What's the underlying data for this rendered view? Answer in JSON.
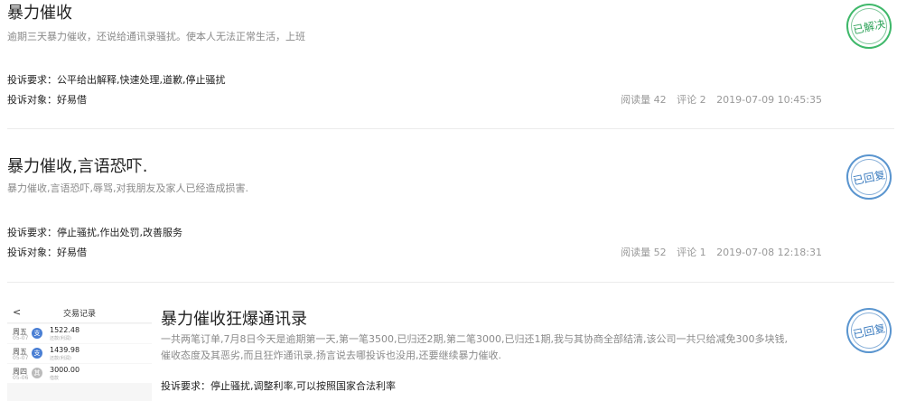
{
  "items": [
    {
      "title": "暴力催收",
      "desc": "逾期三天暴力催收，还说给通讯录骚扰。使本人无法正常生活，上班",
      "demand": "投诉要求：公平给出解释,快速处理,道歉,停止骚扰",
      "target": "投诉对象：好易借",
      "reads": "阅读量 42",
      "comments": "评论 2",
      "time": "2019-07-09 10:45:35",
      "status": "已解决",
      "status_color": "#3fb86a"
    },
    {
      "title": "暴力催收,言语恐吓.",
      "desc": "暴力催收,言语恐吓,辱骂,对我朋友及家人已经造成损害.",
      "demand": "投诉要求：停止骚扰,作出处罚,改善服务",
      "target": "投诉对象：好易借",
      "reads": "阅读量 52",
      "comments": "评论 1",
      "time": "2019-07-08 12:18:31",
      "status": "已回复",
      "status_color": "#5a95cf"
    },
    {
      "title": "暴力催收狂爆通讯录",
      "desc_line1": "一共两笔订单,7月8日今天是逾期第一天,第一笔3500,已归还2期,第二笔3000,已归还1期,我与其协商全部结清,该公司一共只给减免300多块钱,",
      "desc_line2": "催收态度及其恶劣,而且狂炸通讯录,扬言说去哪投诉也没用,还要继续暴力催收.",
      "demand": "投诉要求：停止骚扰,调整利率,可以按照国家合法利率",
      "status": "已回复",
      "status_color": "#5a95cf"
    }
  ],
  "thumbnail": {
    "back": "<",
    "title": "交易记录",
    "rows": [
      {
        "day": "周五",
        "date": "05-07",
        "dot": "支",
        "amount": "1522.48",
        "note": "还款(利润)"
      },
      {
        "day": "周五",
        "date": "05-07",
        "dot": "支",
        "amount": "1439.98",
        "note": "还款(利润)"
      },
      {
        "day": "周四",
        "date": "05-06",
        "dot": "其",
        "amount": "3000.00",
        "note": "借款"
      }
    ]
  }
}
